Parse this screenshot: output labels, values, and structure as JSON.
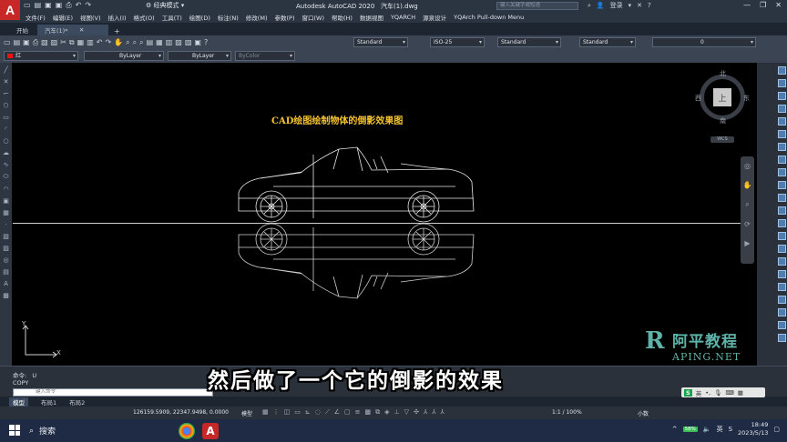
{
  "app": {
    "title": "Autodesk AutoCAD 2020",
    "filename": "汽车(1).dwg",
    "workspace": "经典模式",
    "search_placeholder": "键入关键字或短语",
    "login": "登录"
  },
  "menu": [
    "文件(F)",
    "编辑(E)",
    "视图(V)",
    "插入(I)",
    "格式(O)",
    "工具(T)",
    "绘图(D)",
    "标注(N)",
    "修改(M)",
    "参数(P)",
    "窗口(W)",
    "帮助(H)",
    "数据视图",
    "YQARCH",
    "源泉设计",
    "YQArch Pull-down Menu"
  ],
  "tabs": {
    "start": "开始",
    "file": "汽车(1)*"
  },
  "toolbar": {
    "text_style": "Standard",
    "dim_style": "ISO-25",
    "table_style": "Standard",
    "multileader_style": "Standard",
    "layer": "0",
    "color": "红",
    "linetype": "ByLayer",
    "lineweight": "ByLayer",
    "plotstyle": "ByColor"
  },
  "drawing": {
    "title": "CAD绘图绘制物体的倒影效果图"
  },
  "viewcube": {
    "north": "北",
    "south": "南",
    "east": "东",
    "west": "西",
    "face": "上",
    "wcs": "WCS"
  },
  "ucs": {
    "x": "X",
    "y": "Y"
  },
  "watermark": {
    "cn": "阿平教程",
    "en": "APING.NET",
    "logo": "R"
  },
  "command": {
    "line1_label": "命令:",
    "line1_value": "U",
    "line2": "COPY",
    "input_placeholder": "键入命令"
  },
  "subtitle": "然后做了一个它的倒影的效果",
  "layout_tabs": [
    "模型",
    "布局1",
    "布局2"
  ],
  "status": {
    "coords": "126159.5909, 22347.9498, 0.0000",
    "model": "模型",
    "scale": "1:1 / 100%",
    "units": "小数"
  },
  "ime": {
    "lang": "英"
  },
  "taskbar": {
    "search": "搜索",
    "battery": "58%",
    "ime": "英",
    "time": "18:49",
    "date": "2023/5/13"
  }
}
